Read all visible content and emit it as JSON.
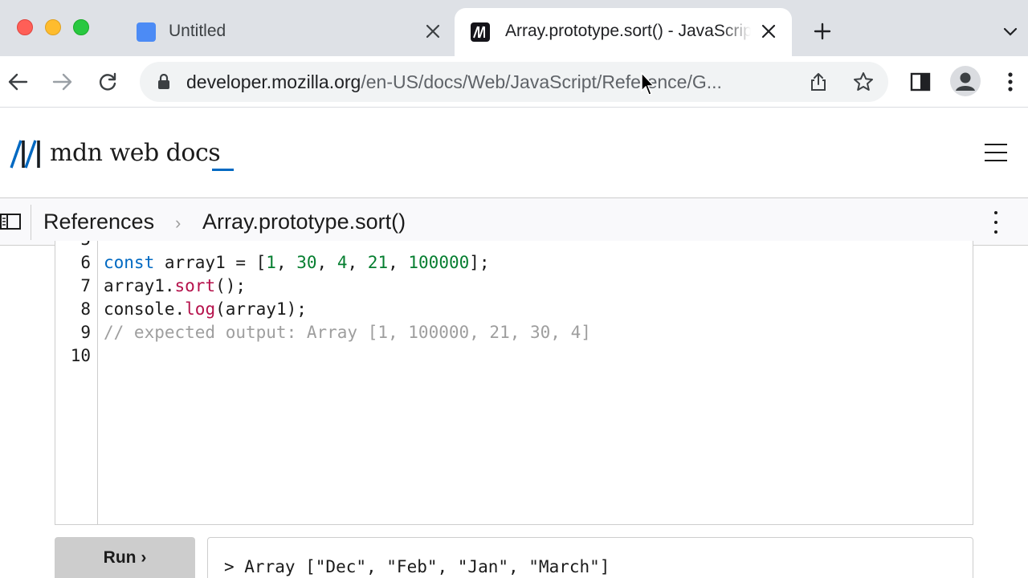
{
  "browser": {
    "tabs": [
      {
        "title": "Untitled",
        "favicon": "doc-icon",
        "active": false
      },
      {
        "title": "Array.prototype.sort() - JavaScript | MDN",
        "favicon": "mdn-icon",
        "active": true
      }
    ],
    "url": {
      "host": "developer.mozilla.org",
      "path": "/en-US/docs/Web/JavaScript/Reference/G..."
    }
  },
  "mdn": {
    "logo_text": "mdn web docs",
    "brand_color": "#0069c2"
  },
  "breadcrumb": {
    "items": [
      "References",
      "Array.prototype.sort()"
    ],
    "separator": "›"
  },
  "editor": {
    "lines": [
      {
        "number": "5",
        "tokens": []
      },
      {
        "number": "6",
        "tokens": [
          {
            "t": "const",
            "k": "kw"
          },
          {
            "t": " array1 = [",
            "k": ""
          },
          {
            "t": "1",
            "k": "num"
          },
          {
            "t": ", ",
            "k": ""
          },
          {
            "t": "30",
            "k": "num"
          },
          {
            "t": ", ",
            "k": ""
          },
          {
            "t": "4",
            "k": "num"
          },
          {
            "t": ", ",
            "k": ""
          },
          {
            "t": "21",
            "k": "num"
          },
          {
            "t": ", ",
            "k": ""
          },
          {
            "t": "100000",
            "k": "num"
          },
          {
            "t": "];",
            "k": ""
          }
        ]
      },
      {
        "number": "7",
        "tokens": [
          {
            "t": "array1.",
            "k": ""
          },
          {
            "t": "sort",
            "k": "fn"
          },
          {
            "t": "();",
            "k": ""
          }
        ]
      },
      {
        "number": "8",
        "tokens": [
          {
            "t": "console.",
            "k": ""
          },
          {
            "t": "log",
            "k": "fn"
          },
          {
            "t": "(array1);",
            "k": ""
          }
        ]
      },
      {
        "number": "9",
        "tokens": [
          {
            "t": "// expected output: Array [1, 100000, 21, 30, 4]",
            "k": "cm"
          }
        ]
      },
      {
        "number": "10",
        "tokens": []
      }
    ]
  },
  "run_label": "Run ›",
  "console_output": "> Array [\"Dec\", \"Feb\", \"Jan\", \"March\"]"
}
